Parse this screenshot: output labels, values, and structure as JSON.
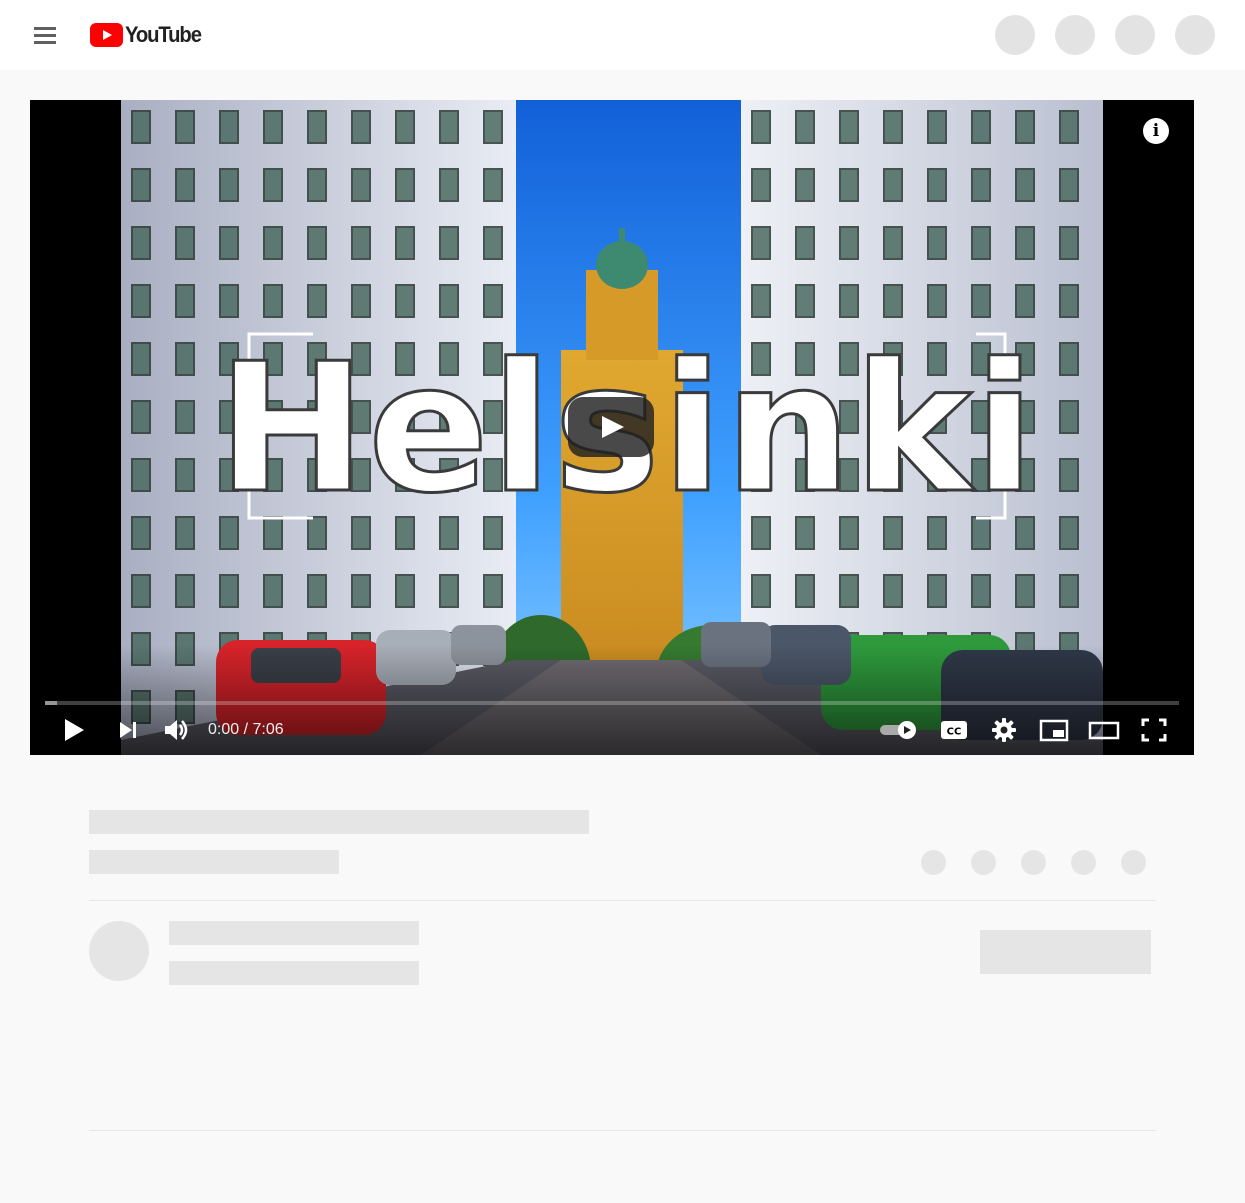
{
  "header": {
    "menu_icon": "hamburger-menu-icon",
    "logo_text": "YouTube",
    "logo_color": "#ff0000",
    "placeholder_buttons": 4
  },
  "player": {
    "thumbnail_title": "Helsinki",
    "current_time": "0:00",
    "duration": "7:06",
    "time_display": "0:00 / 7:06",
    "loaded_fraction": 0.011,
    "autoplay_on": true,
    "icons": {
      "info": "info-icon",
      "big_play": "large-play-icon",
      "play": "play-icon",
      "next": "next-icon",
      "volume": "volume-icon",
      "autoplay": "autoplay-toggle-icon",
      "captions": "captions-icon",
      "settings": "settings-gear-icon",
      "miniplayer": "miniplayer-icon",
      "theater": "theater-mode-icon",
      "fullscreen": "fullscreen-icon"
    }
  },
  "colors": {
    "brand_red": "#ff0000",
    "skeleton": "#e5e5e5",
    "page_bg": "#f9f9f9"
  }
}
